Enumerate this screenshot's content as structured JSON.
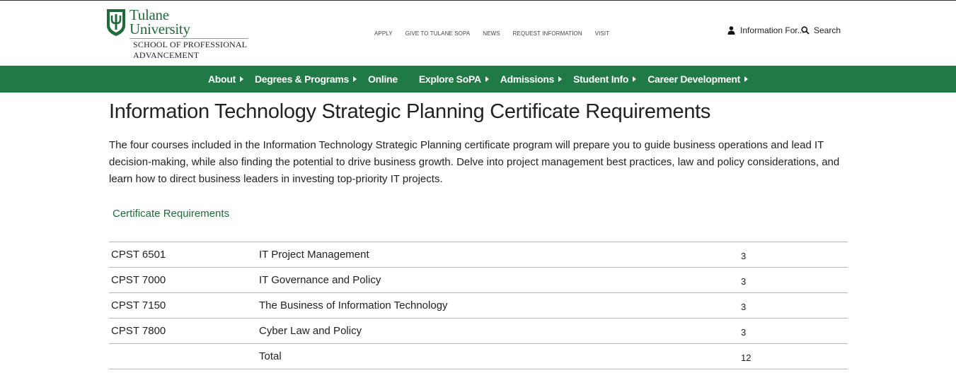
{
  "logo": {
    "line1": "Tulane",
    "line2": "University",
    "school1": "SCHOOL OF PROFESSIONAL",
    "school2": "ADVANCEMENT"
  },
  "utility_nav": [
    "APPLY",
    "GIVE TO TULANE SOPA",
    "NEWS",
    "REQUEST INFORMATION",
    "VISIT"
  ],
  "header_links": {
    "info_for": "Information For...",
    "search": "Search"
  },
  "main_nav": [
    {
      "label": "About",
      "has_submenu": true
    },
    {
      "label": "Degrees & Programs",
      "has_submenu": true
    },
    {
      "label": "Online",
      "has_submenu": false
    },
    {
      "label": "Explore SoPA",
      "has_submenu": true
    },
    {
      "label": "Admissions",
      "has_submenu": true
    },
    {
      "label": "Student Info",
      "has_submenu": true
    },
    {
      "label": "Career Development",
      "has_submenu": true
    }
  ],
  "page": {
    "title": "Information Technology Strategic Planning Certificate Requirements",
    "intro": "The four courses included in the Information Technology Strategic Planning certificate program will prepare you to guide business operations and lead IT decision-making, while also finding the potential to drive business growth. Delve into project management best practices, law and policy considerations, and learn how to direct business leaders in investing top-priority IT projects.",
    "requirements_heading": "Certificate Requirements"
  },
  "courses": [
    {
      "code": "CPST 6501",
      "title": "IT Project Management",
      "credits": "3"
    },
    {
      "code": "CPST 7000",
      "title": "IT Governance and Policy",
      "credits": "3"
    },
    {
      "code": "CPST 7150",
      "title": "The Business of Information Technology",
      "credits": "3"
    },
    {
      "code": "CPST 7800",
      "title": "Cyber Law and Policy",
      "credits": "3"
    }
  ],
  "total": {
    "label": "Total",
    "credits": "12"
  },
  "colors": {
    "brand_green": "#1f7a45",
    "logo_green": "#1f6b3a"
  },
  "icons": {
    "user": "user-icon",
    "search": "search-icon",
    "shield": "tulane-shield-icon"
  }
}
